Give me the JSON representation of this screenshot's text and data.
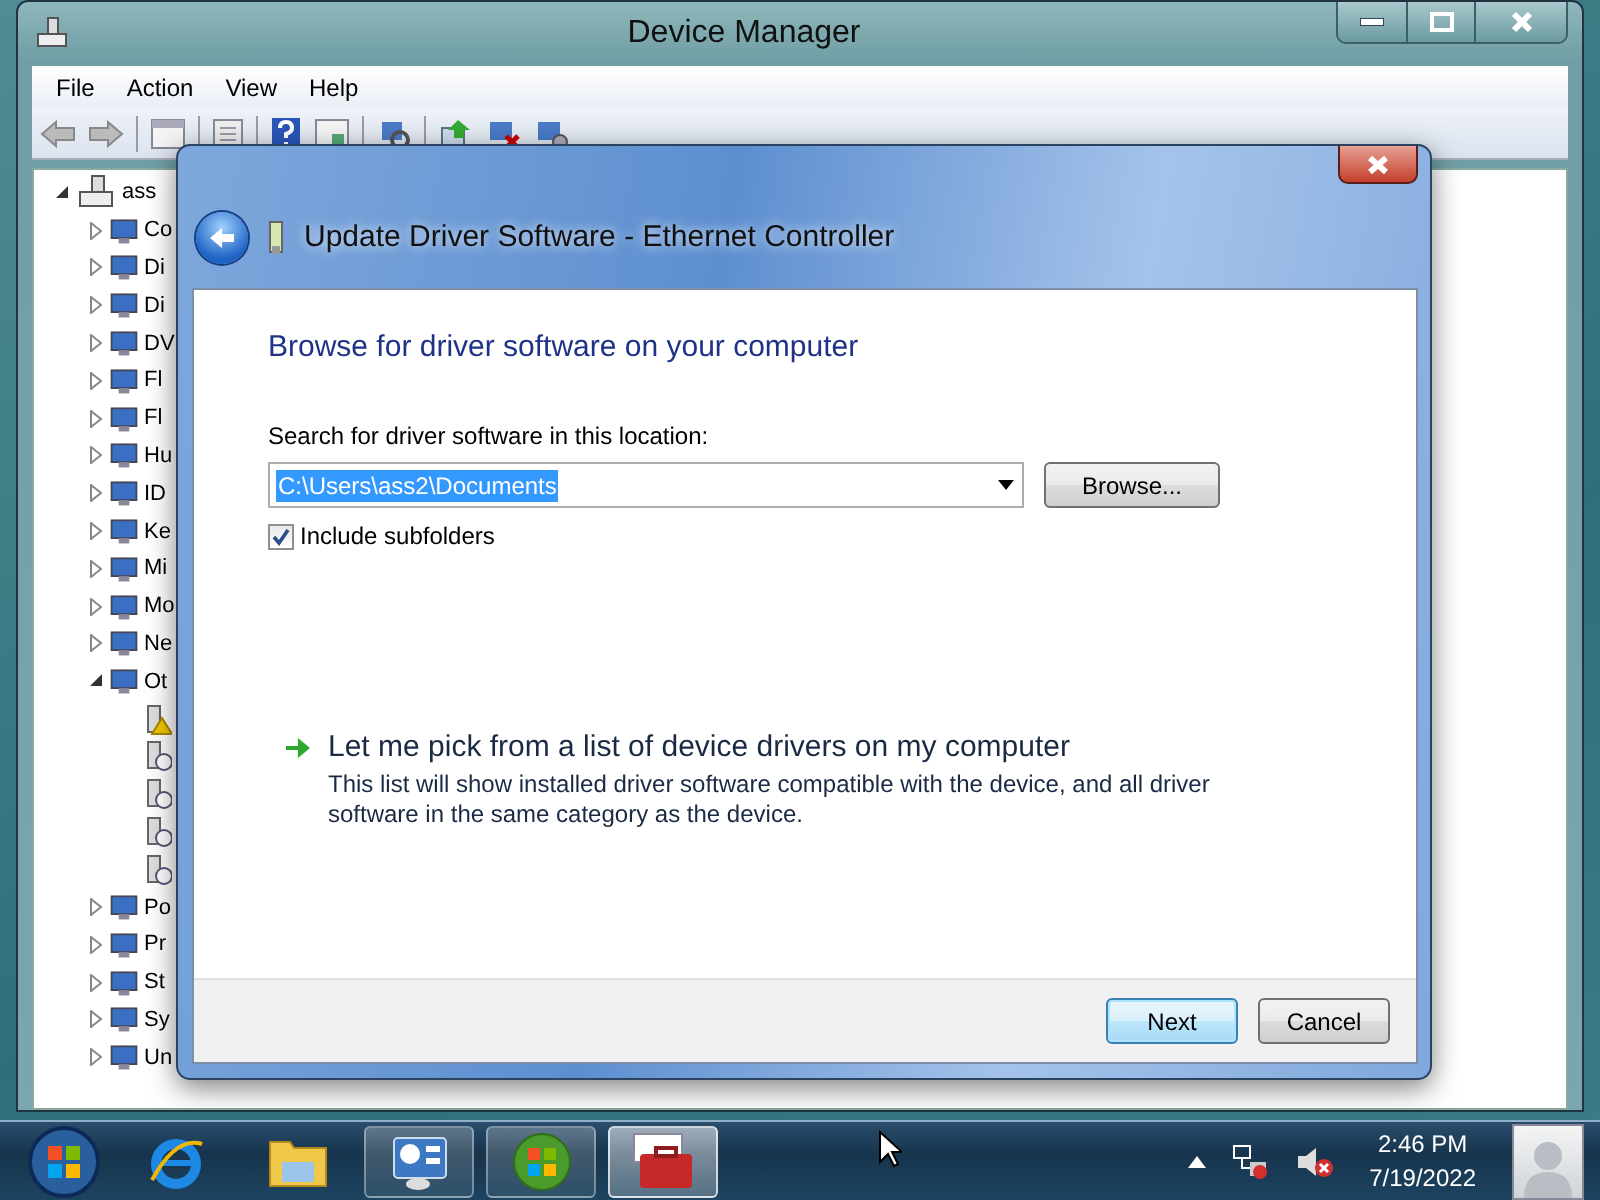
{
  "device_manager": {
    "title": "Device Manager",
    "menu": [
      "File",
      "Action",
      "View",
      "Help"
    ],
    "tree": {
      "label": "ass",
      "expanded": true,
      "children": [
        {
          "label": "Co",
          "expanded": false
        },
        {
          "label": "Di",
          "expanded": false
        },
        {
          "label": "Di",
          "expanded": false
        },
        {
          "label": "DV",
          "expanded": false
        },
        {
          "label": "Fl",
          "expanded": false
        },
        {
          "label": "Fl",
          "expanded": false
        },
        {
          "label": "Hu",
          "expanded": false
        },
        {
          "label": "ID",
          "expanded": false
        },
        {
          "label": "Ke",
          "expanded": false
        },
        {
          "label": "Mi",
          "expanded": false
        },
        {
          "label": "Mo",
          "expanded": false
        },
        {
          "label": "Ne",
          "expanded": false
        },
        {
          "label": "Ot",
          "expanded": true,
          "children": [
            {
              "kind": "warning"
            },
            {
              "kind": "unknown"
            },
            {
              "kind": "unknown"
            },
            {
              "kind": "unknown"
            },
            {
              "kind": "unknown"
            }
          ]
        },
        {
          "label": "Po",
          "expanded": false
        },
        {
          "label": "Pr",
          "expanded": false
        },
        {
          "label": "St",
          "expanded": false
        },
        {
          "label": "Sy",
          "expanded": false
        },
        {
          "label": "Un",
          "expanded": false
        }
      ]
    }
  },
  "dialog": {
    "title": "Update Driver Software - Ethernet Controller",
    "heading": "Browse for driver software on your computer",
    "location_label": "Search for driver software in this location:",
    "location": {
      "value": "C:\\Users\\ass2\\Documents",
      "text_selected": true
    },
    "browse_button": "Browse...",
    "include_subfolders": {
      "label": "Include subfolders",
      "checked": true
    },
    "options": [
      {
        "title": "Let me pick from a list of device drivers on my computer",
        "description": "This list will show installed driver software compatible with the device, and all driver software in the same category as the device."
      }
    ],
    "buttons": [
      {
        "label": "Next",
        "default": true
      },
      {
        "label": "Cancel",
        "default": false
      }
    ]
  },
  "taskbar": {
    "items": [
      {
        "kind": "browser",
        "running": false,
        "selected": false
      },
      {
        "kind": "folder",
        "running": false,
        "selected": false
      },
      {
        "kind": "control-panel",
        "running": true,
        "selected": false
      },
      {
        "kind": "orb",
        "running": true,
        "selected": false
      },
      {
        "kind": "toolbox",
        "running": true,
        "selected": true
      }
    ],
    "clock": {
      "time": "2:46 PM",
      "date": "7/19/2022"
    }
  }
}
